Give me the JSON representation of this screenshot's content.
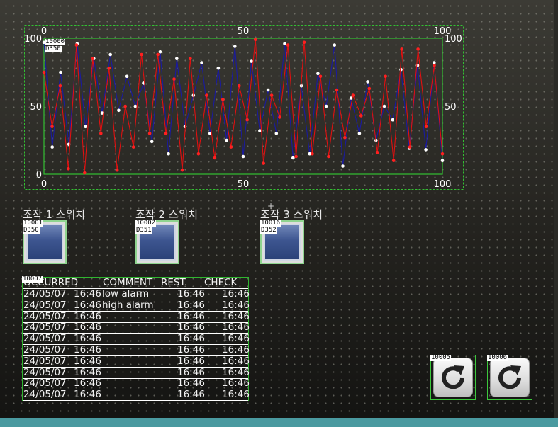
{
  "trend": {
    "tag_id": "10000",
    "tag_addr": "D350",
    "top_axis": [
      "0",
      "50",
      "100"
    ],
    "bottom_axis": [
      "0",
      "50",
      "100"
    ],
    "left_axis": [
      "100",
      "50",
      "0"
    ],
    "right_axis": [
      "100",
      "50"
    ],
    "colors": {
      "series1": "#1a1aa0",
      "series2": "#e01010",
      "border": "#33c033",
      "markers1": "#ffffff",
      "markers2": "#ff2020"
    }
  },
  "chart_data": {
    "type": "line",
    "x_range": [
      0,
      100
    ],
    "y_range": [
      0,
      100
    ],
    "series": [
      {
        "values": [
          97,
          20,
          75,
          22,
          96,
          35,
          85,
          45,
          88,
          47,
          72,
          50,
          67,
          24,
          90,
          15,
          85,
          35,
          58,
          82,
          30,
          78,
          25,
          94,
          13,
          83,
          32,
          62,
          30,
          96,
          12,
          65,
          15,
          74,
          50,
          95,
          6,
          56,
          30,
          68,
          25,
          50,
          40,
          77,
          19,
          80,
          18,
          82,
          10
        ]
      },
      {
        "values": [
          75,
          35,
          65,
          4,
          95,
          1,
          85,
          30,
          78,
          3,
          50,
          20,
          88,
          30,
          88,
          30,
          70,
          3,
          85,
          15,
          58,
          12,
          55,
          20,
          65,
          40,
          99,
          8,
          58,
          42,
          95,
          13,
          97,
          15,
          72,
          13,
          62,
          27,
          58,
          43,
          63,
          16,
          72,
          10,
          92,
          20,
          92,
          35,
          80,
          15
        ]
      }
    ]
  },
  "switches": [
    {
      "label": "조작 1 스위치",
      "tag_id": "10001",
      "tag_addr": "D350"
    },
    {
      "label": "조작 2 스위치",
      "tag_id": "10002",
      "tag_addr": "D351"
    },
    {
      "label": "조작 3 스위치",
      "tag_id": "10016",
      "tag_addr": "D352"
    }
  ],
  "alarm": {
    "tag_id": "10007",
    "headers": {
      "occurred": "OCCURRED",
      "comment": "COMMENT",
      "rest": "REST.",
      "check": "CHECK"
    },
    "rows": [
      {
        "date": "24/05/07",
        "time": "16:46",
        "comment": "low alarm",
        "rest": "16:46",
        "check": "16:46"
      },
      {
        "date": "24/05/07",
        "time": "16:46",
        "comment": "high alarm",
        "rest": "16:46",
        "check": "16:46"
      },
      {
        "date": "24/05/07",
        "time": "16:46",
        "comment": "",
        "rest": "16:46",
        "check": "16:46"
      },
      {
        "date": "24/05/07",
        "time": "16:46",
        "comment": "",
        "rest": "16:46",
        "check": "16:46"
      },
      {
        "date": "24/05/07",
        "time": "16:46",
        "comment": "",
        "rest": "16:46",
        "check": "16:46"
      },
      {
        "date": "24/05/07",
        "time": "16:46",
        "comment": "",
        "rest": "16:46",
        "check": "16:46"
      },
      {
        "date": "24/05/07",
        "time": "16:46",
        "comment": "",
        "rest": "16:46",
        "check": "16:46"
      },
      {
        "date": "24/05/07",
        "time": "16:46",
        "comment": "",
        "rest": "16:46",
        "check": "16:46"
      },
      {
        "date": "24/05/07",
        "time": "16:46",
        "comment": "",
        "rest": "16:46",
        "check": "16:46"
      },
      {
        "date": "24/05/07",
        "time": "16:46",
        "comment": "",
        "rest": "16:46",
        "check": "16:46"
      }
    ]
  },
  "reset_buttons": [
    {
      "tag_id": "10005",
      "icon": "reset-icon"
    },
    {
      "tag_id": "10006",
      "icon": "reset-icon"
    }
  ]
}
